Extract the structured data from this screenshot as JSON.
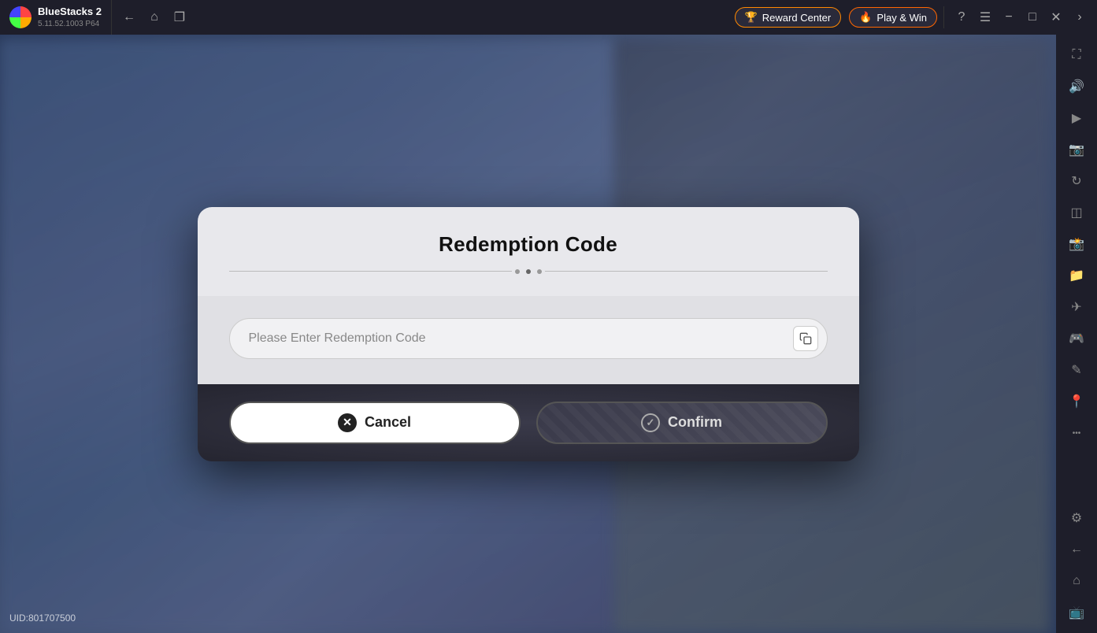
{
  "app": {
    "name": "BlueStacks 2",
    "version": "5.11.52.1003  P64",
    "logo_alt": "bluestacks-logo"
  },
  "topbar": {
    "nav": {
      "back_label": "←",
      "home_label": "⌂",
      "windows_label": "❐"
    },
    "reward_center": "Reward Center",
    "play_win": "Play & Win",
    "controls": {
      "help": "?",
      "menu": "≡",
      "minimize": "−",
      "restore": "□",
      "close": "✕",
      "expand": "›"
    }
  },
  "sidebar": {
    "buttons": [
      {
        "name": "fullscreen-icon",
        "icon": "⛶"
      },
      {
        "name": "volume-icon",
        "icon": "🔊"
      },
      {
        "name": "video-icon",
        "icon": "▶"
      },
      {
        "name": "screenshot-icon",
        "icon": "📷"
      },
      {
        "name": "rotate-icon",
        "icon": "↻"
      },
      {
        "name": "layers-icon",
        "icon": "⊞"
      },
      {
        "name": "camera-icon",
        "icon": "📸"
      },
      {
        "name": "folder-icon",
        "icon": "📁"
      },
      {
        "name": "airplane-icon",
        "icon": "✈"
      },
      {
        "name": "gamepad-icon",
        "icon": "🎮"
      },
      {
        "name": "brush-icon",
        "icon": "✏"
      },
      {
        "name": "location-icon",
        "icon": "📍"
      },
      {
        "name": "more-icon",
        "icon": "•••"
      },
      {
        "name": "settings-icon",
        "icon": "⚙"
      },
      {
        "name": "back-icon",
        "icon": "←"
      },
      {
        "name": "home-sidebar-icon",
        "icon": "⌂"
      },
      {
        "name": "tv-icon",
        "icon": "📺"
      }
    ]
  },
  "dialog": {
    "title": "Redemption Code",
    "input_placeholder": "Please Enter Redemption Code",
    "cancel_label": "Cancel",
    "confirm_label": "Confirm"
  },
  "uid": {
    "label": "UID:801707500"
  }
}
